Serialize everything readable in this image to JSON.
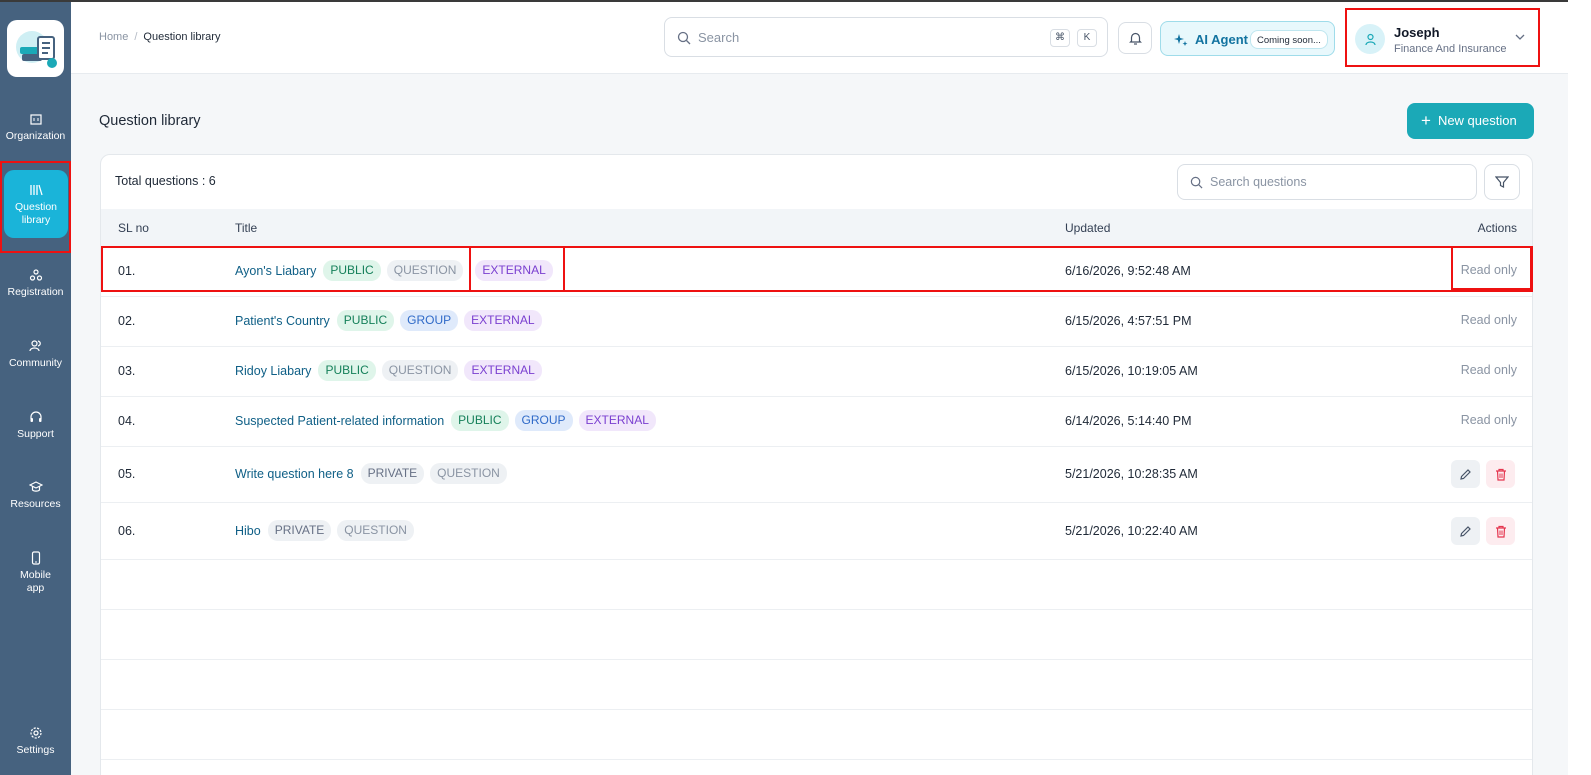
{
  "sidebar": {
    "items": [
      {
        "label": "Organization",
        "icon": "building-icon"
      },
      {
        "label": "Question library",
        "icon": "library-icon",
        "active": true
      },
      {
        "label": "Registration",
        "icon": "registration-icon"
      },
      {
        "label": "Community",
        "icon": "community-icon"
      },
      {
        "label": "Support",
        "icon": "headset-icon"
      },
      {
        "label": "Resources",
        "icon": "graduation-cap-icon"
      },
      {
        "label": "Mobile app",
        "icon": "mobile-icon"
      },
      {
        "label": "Settings",
        "icon": "gear-icon"
      }
    ]
  },
  "header": {
    "breadcrumb": {
      "home": "Home",
      "separator": "/",
      "current": "Question library"
    },
    "search": {
      "placeholder": "Search",
      "shortcut_1": "⌘",
      "shortcut_2": "K"
    },
    "ai_agent": {
      "label": "AI Agent",
      "badge": "Coming soon..."
    },
    "user": {
      "name": "Joseph",
      "org": "Finance And Insurance"
    }
  },
  "main": {
    "title": "Question library",
    "new_button": "New question",
    "total_label": "Total questions : 6",
    "search_placeholder": "Search questions",
    "columns": {
      "sl": "SL no",
      "title": "Title",
      "updated": "Updated",
      "actions": "Actions"
    },
    "rows": [
      {
        "sl": "01.",
        "title": "Ayon's Liabary",
        "tags": [
          "PUBLIC",
          "QUESTION",
          "EXTERNAL"
        ],
        "updated": "6/16/2026, 9:52:48 AM",
        "action": "Read only"
      },
      {
        "sl": "02.",
        "title": "Patient's Country",
        "tags": [
          "PUBLIC",
          "GROUP",
          "EXTERNAL"
        ],
        "updated": "6/15/2026, 4:57:51 PM",
        "action": "Read only"
      },
      {
        "sl": "03.",
        "title": "Ridoy Liabary",
        "tags": [
          "PUBLIC",
          "QUESTION",
          "EXTERNAL"
        ],
        "updated": "6/15/2026, 10:19:05 AM",
        "action": "Read only"
      },
      {
        "sl": "04.",
        "title": "Suspected Patient-related information",
        "tags": [
          "PUBLIC",
          "GROUP",
          "EXTERNAL"
        ],
        "updated": "6/14/2026, 5:14:40 PM",
        "action": "Read only"
      },
      {
        "sl": "05.",
        "title": "Write question here 8",
        "tags": [
          "PRIVATE",
          "QUESTION"
        ],
        "updated": "5/21/2026, 10:28:35 AM",
        "action": "edit-delete"
      },
      {
        "sl": "06.",
        "title": "Hibo",
        "tags": [
          "PRIVATE",
          "QUESTION"
        ],
        "updated": "5/21/2026, 10:22:40 AM",
        "action": "edit-delete"
      }
    ]
  },
  "colors": {
    "sidebar": "#46627f",
    "active_nav": "#1ab4d9",
    "primary_button": "#1ba9b7",
    "highlight_box": "#ee1111"
  }
}
